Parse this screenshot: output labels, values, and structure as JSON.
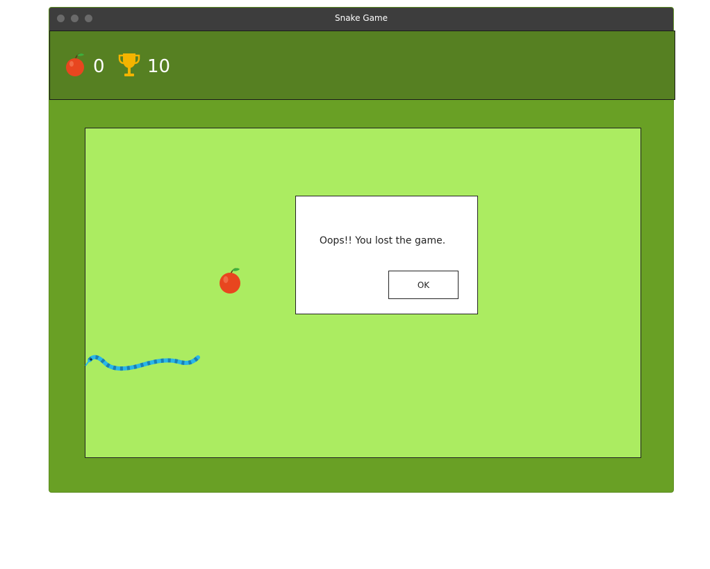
{
  "window": {
    "title": "Snake Game"
  },
  "scorebar": {
    "score_icon": "apple-icon",
    "score": "0",
    "highscore_icon": "trophy-icon",
    "highscore": "10"
  },
  "board": {
    "food_icon": "apple-icon",
    "snake_color": "#29b6e8"
  },
  "dialog": {
    "message": "Oops!! You lost the game.",
    "ok_label": "OK"
  },
  "colors": {
    "window_bg": "#69a025",
    "scorebar_bg": "#568022",
    "board_bg": "#abec61",
    "titlebar_bg": "#3d3d3d",
    "apple": "#e8461f",
    "trophy": "#f4b400"
  }
}
